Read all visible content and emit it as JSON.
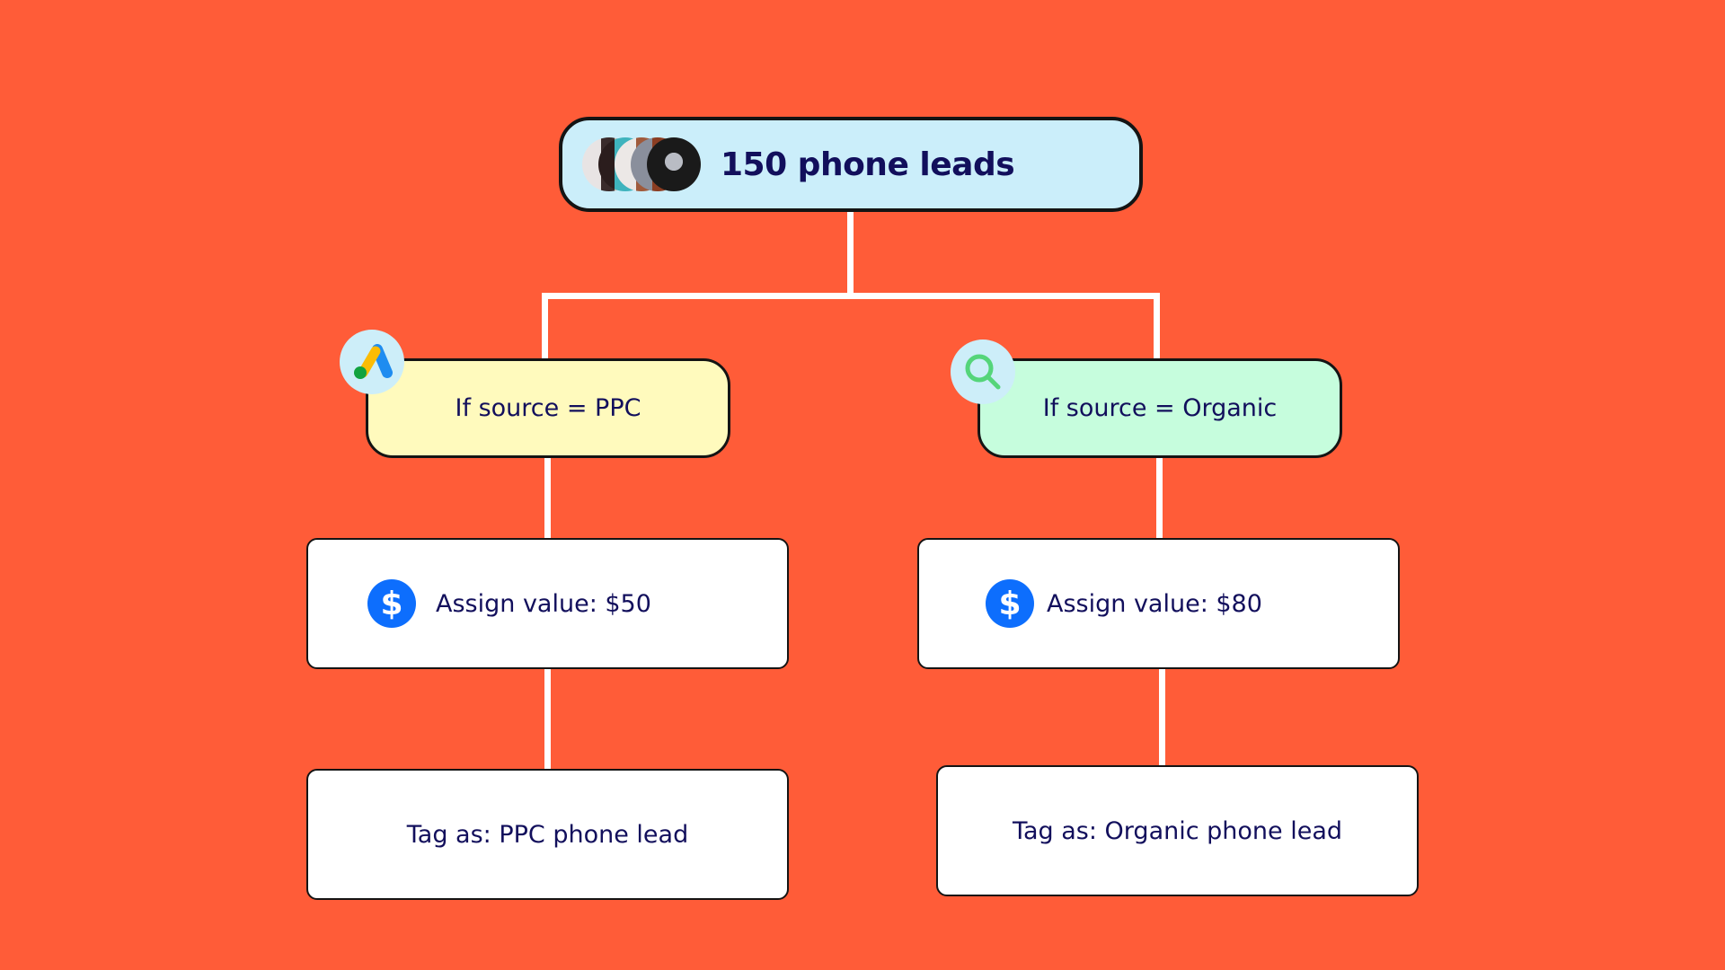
{
  "colors": {
    "background": "#ff5c38",
    "root_fill": "#cbeefa",
    "ppc_fill": "#fffabd",
    "organic_fill": "#c6fddd",
    "text": "#120f5c",
    "dollar_icon": "#0d6efd",
    "connector": "#ffffff"
  },
  "root": {
    "title": "150 phone leads",
    "avatars": [
      "avatar-1",
      "avatar-2",
      "avatar-3",
      "avatar-4",
      "avatar-5"
    ]
  },
  "branches": [
    {
      "icon": "google-ads-icon",
      "condition": "If source = PPC",
      "assign_icon": "dollar-icon",
      "assign": "Assign value: $50",
      "tag": "Tag as: PPC phone lead"
    },
    {
      "icon": "search-icon",
      "condition": "If source = Organic",
      "assign_icon": "dollar-icon",
      "assign": "Assign value: $80",
      "tag": "Tag as: Organic phone lead"
    }
  ],
  "dollar_glyph": "$"
}
